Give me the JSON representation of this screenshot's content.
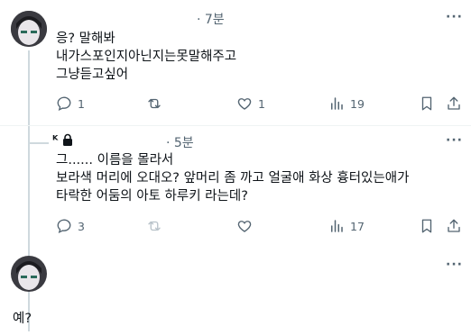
{
  "tweet1": {
    "time": "· 7분",
    "lines": [
      "응? 말해봐",
      "내가스포인지아닌지는못말해주고",
      "그냥듣고싶어"
    ],
    "reply_count": "1",
    "like_count": "1",
    "view_count": "19"
  },
  "tweet2": {
    "username": "ᴷ",
    "time": "· 5분",
    "lines": [
      "그...... 이름을 몰라서",
      "보라색 머리에 오대오? 앞머리 좀 까고 얼굴애 화상 흉터있는애가",
      "타락한 어둠의 아토 하루키 라는데?"
    ],
    "reply_count": "3",
    "view_count": "17"
  },
  "tweet3": {
    "text": "예?"
  },
  "more_label": "···",
  "colors": {
    "text": "#0f1419",
    "muted": "#536471",
    "line": "#cfd9de"
  }
}
